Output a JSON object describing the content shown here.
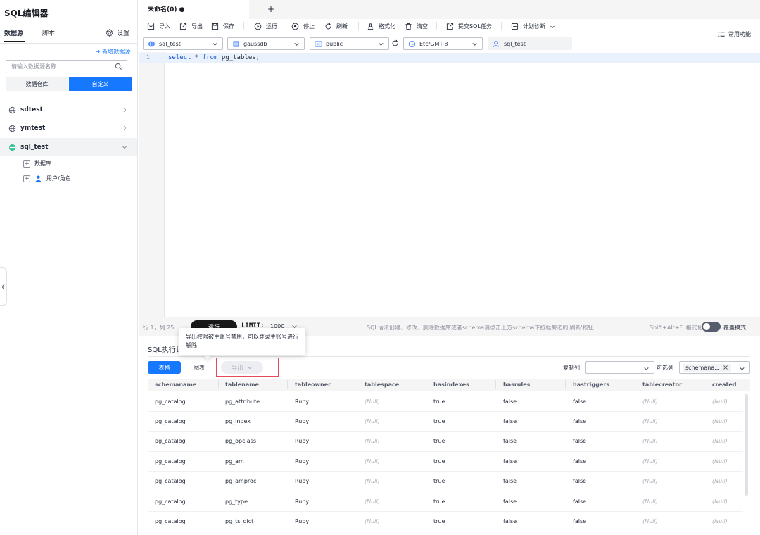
{
  "sidebar": {
    "title": "SQL编辑器",
    "tabs": [
      "数据源",
      "脚本"
    ],
    "settings_label": "设置",
    "new_datasource": "+ 新增数据源",
    "search_placeholder": "请输入数据源名称",
    "segments": [
      "数据仓库",
      "自定义"
    ],
    "datasources": [
      {
        "name": "sdtest",
        "expanded": false
      },
      {
        "name": "ymtest",
        "expanded": false
      },
      {
        "name": "sql_test",
        "expanded": true
      }
    ],
    "tree_children": [
      "数据库",
      "用户/角色"
    ]
  },
  "editor_tabs": {
    "active_tab": "未命名(0) ●",
    "add_tab": "+"
  },
  "toolbar": {
    "import": "导入",
    "export": "导出",
    "save": "保存",
    "run": "运行",
    "stop": "停止",
    "refresh": "刷新",
    "format": "格式化",
    "clear": "清空",
    "submit_sql_task": "提交SQL任务",
    "plan_diagnose": "计划诊断",
    "common_functions": "常用功能"
  },
  "selectors": {
    "datasource": "sql_test",
    "database": "gaussdb",
    "schema": "public",
    "timezone": "Etc/GMT-8",
    "user": "sql_test"
  },
  "editor": {
    "line_number": "1",
    "code_keyword1": "select",
    "code_mid": " * ",
    "code_keyword2": "from",
    "code_rest": " pg_tables;"
  },
  "statusbar": {
    "cursor": "行 1，列 25",
    "run_button": "运行",
    "limit_label": "LIMIT:",
    "limit_value": "1000",
    "hint": "SQL语法创建、修改、删除数据库或者schema请点击上方schema下拉框旁边的'刷新'按钮",
    "format_shortcut": "Shift+Alt+F: 格式化",
    "overwrite_mode": "覆盖模式"
  },
  "result": {
    "title": "SQL执行记",
    "view_table": "表格",
    "view_chart": "图表",
    "export_button": "导出",
    "tooltip": "导出权限被主账号禁用，可以登录主账号进行解除",
    "copy_column_label": "复制列",
    "optional_column_label": "可选列",
    "optional_column_tag": "schemana...",
    "columns": [
      "schemaname",
      "tablename",
      "tableowner",
      "tablespace",
      "hasindexes",
      "hasrules",
      "hastriggers",
      "tablecreator",
      "created"
    ],
    "rows": [
      [
        "pg_catalog",
        "pg_attribute",
        "Ruby",
        "(Null)",
        "true",
        "false",
        "false",
        "(Null)",
        "(Null)"
      ],
      [
        "pg_catalog",
        "pg_index",
        "Ruby",
        "(Null)",
        "true",
        "false",
        "false",
        "(Null)",
        "(Null)"
      ],
      [
        "pg_catalog",
        "pg_opclass",
        "Ruby",
        "(Null)",
        "true",
        "false",
        "false",
        "(Null)",
        "(Null)"
      ],
      [
        "pg_catalog",
        "pg_am",
        "Ruby",
        "(Null)",
        "true",
        "false",
        "false",
        "(Null)",
        "(Null)"
      ],
      [
        "pg_catalog",
        "pg_amproc",
        "Ruby",
        "(Null)",
        "true",
        "false",
        "false",
        "(Null)",
        "(Null)"
      ],
      [
        "pg_catalog",
        "pg_type",
        "Ruby",
        "(Null)",
        "true",
        "false",
        "false",
        "(Null)",
        "(Null)"
      ],
      [
        "pg_catalog",
        "pg_ts_dict",
        "Ruby",
        "(Null)",
        "true",
        "false",
        "false",
        "(Null)",
        "(Null)"
      ]
    ]
  },
  "colors": {
    "primary": "#1677ff",
    "dark_button": "#191919",
    "highlight_border": "#e34d59",
    "db_icon_green": "#3ac295"
  }
}
